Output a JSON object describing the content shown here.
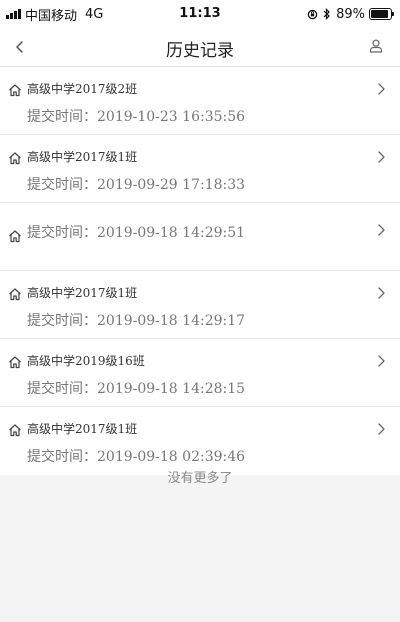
{
  "status_bar": {
    "carrier": "中国移动",
    "network": "4G",
    "time": "11:13",
    "battery_percent": "89%",
    "battery_level": 0.89,
    "icons": [
      "signal-icon",
      "orientation-lock-icon",
      "bluetooth-icon",
      "battery-icon"
    ]
  },
  "nav": {
    "title": "历史记录",
    "back_icon": "chevron-left-icon",
    "user_icon": "user-icon"
  },
  "records": [
    {
      "class_name": "高级中学2017级2班",
      "time_label": "提交时间：",
      "time": "2019-10-23 16:35:56"
    },
    {
      "class_name": "高级中学2017级1班",
      "time_label": "提交时间：",
      "time": "2019-09-29 17:18:33"
    },
    {
      "class_name": "",
      "time_label": "提交时间：",
      "time": "2019-09-18 14:29:51"
    },
    {
      "class_name": "高级中学2017级1班",
      "time_label": "提交时间：",
      "time": "2019-09-18 14:29:17"
    },
    {
      "class_name": "高级中学2019级16班",
      "time_label": "提交时间：",
      "time": "2019-09-18 14:28:15"
    },
    {
      "class_name": "高级中学2017级1班",
      "time_label": "提交时间：",
      "time": "2019-09-18 02:39:46"
    }
  ],
  "footer": {
    "no_more": "没有更多了"
  },
  "colors": {
    "background": "#f4f4f4",
    "card": "#ffffff",
    "text_primary": "#333333",
    "text_secondary": "#777777"
  }
}
